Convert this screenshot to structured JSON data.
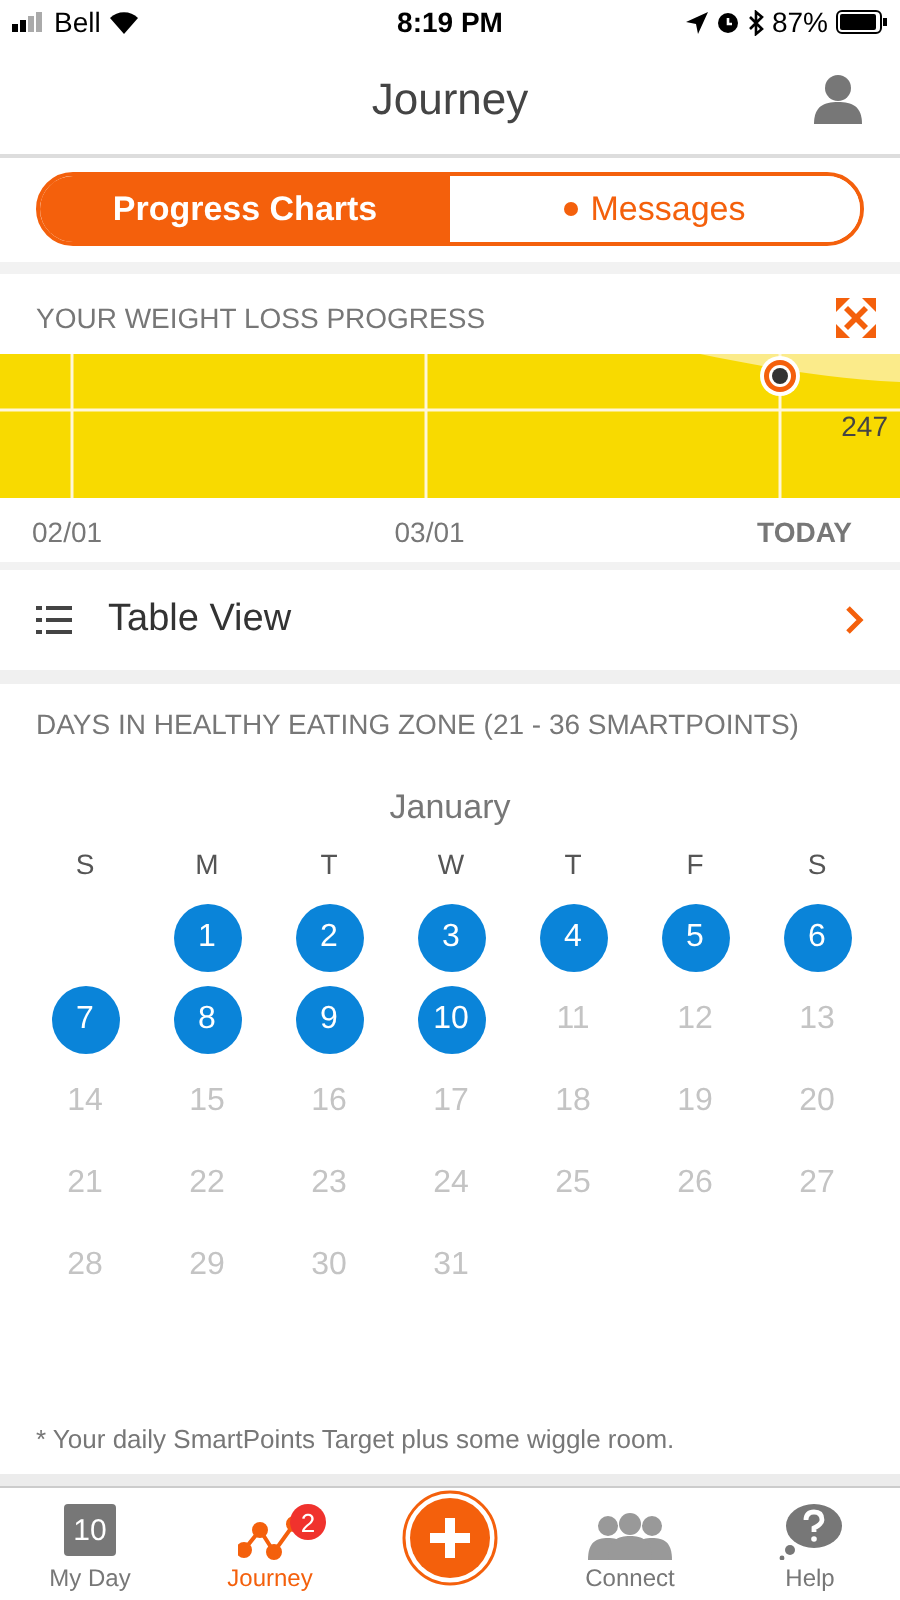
{
  "status_bar": {
    "carrier": "Bell",
    "time": "8:19 PM",
    "battery": "87%"
  },
  "header": {
    "title": "Journey"
  },
  "segments": [
    {
      "label": "Progress Charts",
      "selected": true,
      "dot": false
    },
    {
      "label": "Messages",
      "selected": false,
      "dot": true
    }
  ],
  "weight_card": {
    "title": "YOUR WEIGHT LOSS PROGRESS",
    "current_value": "247",
    "x_labels": [
      {
        "label": "02/01",
        "bold": false
      },
      {
        "label": "03/01",
        "bold": false
      },
      {
        "label": "TODAY",
        "bold": true
      }
    ]
  },
  "table_view": {
    "label": "Table View"
  },
  "healthy_zone": {
    "title": "DAYS IN HEALTHY EATING ZONE (21 - 36 SMARTPOINTS)",
    "month": "January",
    "weekdays": [
      "S",
      "M",
      "T",
      "W",
      "T",
      "F",
      "S"
    ],
    "weeks": [
      [
        {
          "day": "1",
          "in_zone": true
        },
        {
          "day": "2",
          "in_zone": true
        },
        {
          "day": "3",
          "in_zone": true
        },
        {
          "day": "4",
          "in_zone": true
        },
        {
          "day": "5",
          "in_zone": true
        },
        {
          "day": "6",
          "in_zone": true
        }
      ],
      [
        {
          "day": "7",
          "in_zone": true
        },
        {
          "day": "8",
          "in_zone": true
        },
        {
          "day": "9",
          "in_zone": true
        },
        {
          "day": "10",
          "in_zone": true
        },
        {
          "day": "11",
          "in_zone": false
        },
        {
          "day": "12",
          "in_zone": false
        },
        {
          "day": "13",
          "in_zone": false
        }
      ],
      [
        {
          "day": "14",
          "in_zone": false
        },
        {
          "day": "15",
          "in_zone": false
        },
        {
          "day": "16",
          "in_zone": false
        },
        {
          "day": "17",
          "in_zone": false
        },
        {
          "day": "18",
          "in_zone": false
        },
        {
          "day": "19",
          "in_zone": false
        },
        {
          "day": "20",
          "in_zone": false
        }
      ],
      [
        {
          "day": "21",
          "in_zone": false
        },
        {
          "day": "22",
          "in_zone": false
        },
        {
          "day": "23",
          "in_zone": false
        },
        {
          "day": "24",
          "in_zone": false
        },
        {
          "day": "25",
          "in_zone": false
        },
        {
          "day": "26",
          "in_zone": false
        },
        {
          "day": "27",
          "in_zone": false
        }
      ],
      [
        {
          "day": "28",
          "in_zone": false
        },
        {
          "day": "29",
          "in_zone": false
        },
        {
          "day": "30",
          "in_zone": false
        },
        {
          "day": "31",
          "in_zone": false
        }
      ]
    ],
    "footnote": "* Your daily SmartPoints Target plus some wiggle room."
  },
  "tab_bar": [
    {
      "kind": "calendar",
      "label": "My Day",
      "icon_text": "10",
      "selected": false
    },
    {
      "kind": "journey",
      "label": "Journey",
      "badge": "2",
      "selected": true
    },
    {
      "kind": "add"
    },
    {
      "kind": "connect",
      "label": "Connect",
      "selected": false
    },
    {
      "kind": "help",
      "label": "Help",
      "selected": false
    }
  ]
}
